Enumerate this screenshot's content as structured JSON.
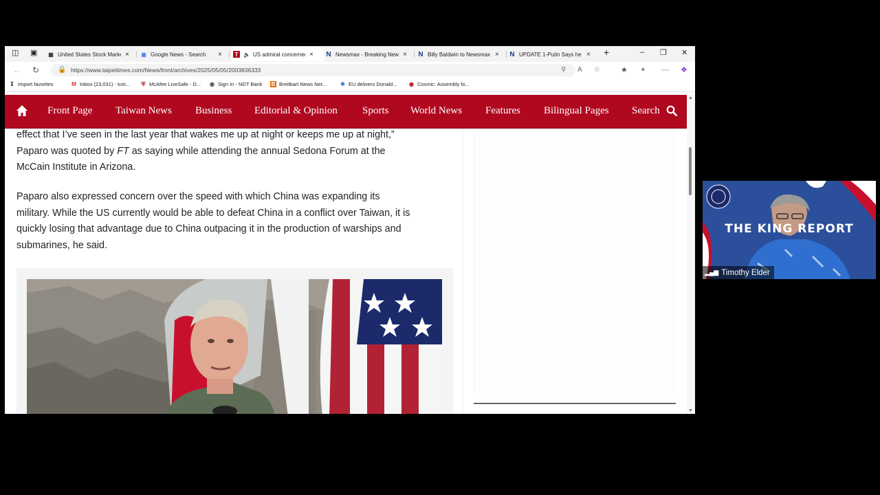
{
  "browser": {
    "tabs": [
      {
        "title": "United States Stock Market",
        "favicon": "tradingeconomics-icon"
      },
      {
        "title": "Google News - Search",
        "favicon": "google-news-icon"
      },
      {
        "title": "US admiral concerned",
        "favicon": "taipei-times-icon",
        "active": true
      },
      {
        "title": "Newsmax - Breaking News",
        "favicon": "newsmax-icon"
      },
      {
        "title": "Billy Baldwin to Newsmax",
        "favicon": "newsmax-icon"
      },
      {
        "title": "UPDATE 1-Putin Says he H",
        "favicon": "newsmax-icon"
      }
    ],
    "url": "https://www.taipeitimes.com/News/front/archives/2025/05/05/2003836333",
    "favorites": [
      {
        "label": "Import favorites",
        "icon": "import-icon"
      },
      {
        "label": "Inbox (23,031) - tcei...",
        "icon": "gmail-icon"
      },
      {
        "label": "McAfee LiveSafe - D...",
        "icon": "mcafee-icon"
      },
      {
        "label": "Sign In - NDT Bank",
        "icon": "globe-icon"
      },
      {
        "label": "Breitbart News Net...",
        "icon": "breitbart-icon"
      },
      {
        "label": "EU delivers Donald...",
        "icon": "news-icon"
      },
      {
        "label": "Cosmic: Assembly fo...",
        "icon": "cosmic-icon"
      }
    ]
  },
  "site": {
    "nav": [
      "Front Page",
      "Taiwan News",
      "Business",
      "Editorial & Opinion",
      "Sports",
      "World News",
      "Features",
      "Bilingual Pages"
    ],
    "search_label": "Search",
    "accent_color": "#b0081f"
  },
  "article": {
    "p1_line1": "effect that I’ve seen in the last year that wakes me up at night or keeps me up at night,”",
    "p1_line2_a": "Paparo was quoted by ",
    "p1_line2_ft": "FT",
    "p1_line2_b": " as saying while attending the annual Sedona Forum at the",
    "p1_line3": "McCain Institute in Arizona.",
    "p2_line1": "Paparo also expressed concern over the speed with which China was expanding its",
    "p2_line2": "military. While the US currently would be able to defeat China in a conflict over Taiwan, it is",
    "p2_line3": "quickly losing that advantage due to China outpacing it in the production of warships and",
    "p2_line4": "submarines, he said."
  },
  "video_overlay": {
    "banner": "THE KING REPORT",
    "participant": "Timothy Elder"
  }
}
